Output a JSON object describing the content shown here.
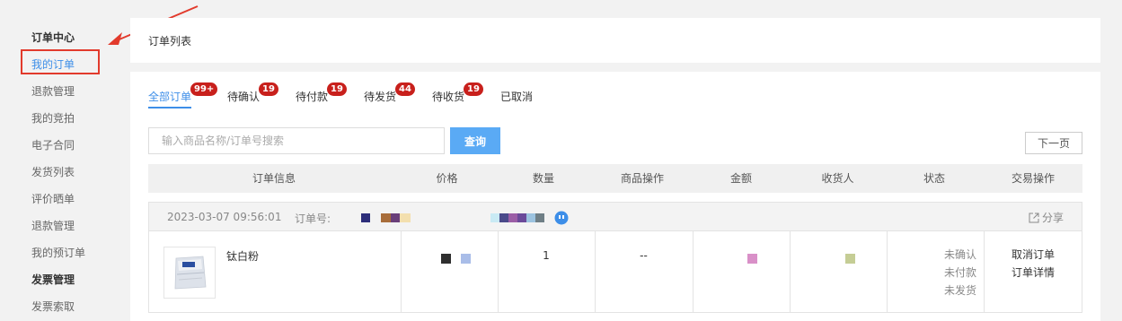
{
  "sidebar": {
    "items": [
      {
        "label": "订单中心",
        "type": "header"
      },
      {
        "label": "我的订单",
        "type": "active"
      },
      {
        "label": "退款管理",
        "type": "item"
      },
      {
        "label": "我的竞拍",
        "type": "item"
      },
      {
        "label": "电子合同",
        "type": "item"
      },
      {
        "label": "发货列表",
        "type": "item"
      },
      {
        "label": "评价晒单",
        "type": "item"
      },
      {
        "label": "退款管理",
        "type": "item"
      },
      {
        "label": "我的预订单",
        "type": "item"
      },
      {
        "label": "发票管理",
        "type": "header"
      },
      {
        "label": "发票索取",
        "type": "item"
      }
    ],
    "annotation_color": "#e23a2c"
  },
  "page_title": "订单列表",
  "tabs": [
    {
      "label": "全部订单",
      "badge": "99+"
    },
    {
      "label": "待确认",
      "badge": "19"
    },
    {
      "label": "待付款",
      "badge": "19"
    },
    {
      "label": "待发货",
      "badge": "44"
    },
    {
      "label": "待收货",
      "badge": "19"
    },
    {
      "label": "已取消",
      "badge": ""
    }
  ],
  "search": {
    "placeholder": "输入商品名称/订单号搜索",
    "button": "查询"
  },
  "pagination": {
    "next": "下一页"
  },
  "table_headers": [
    "订单信息",
    "价格",
    "数量",
    "商品操作",
    "金额",
    "收货人",
    "状态",
    "交易操作"
  ],
  "order": {
    "time": "2023-03-07 09:56:01",
    "order_no_label": "订单号:",
    "share": "分享",
    "product_name": "钛白粉",
    "quantity": "1",
    "product_ops": "--",
    "status": [
      "未确认",
      "未付款",
      "未发货"
    ],
    "actions": [
      "取消订单",
      "订单详情"
    ]
  },
  "colors": {
    "accent": "#3d8ee8",
    "badge": "#c8201c",
    "search_button": "#5aaaf5"
  }
}
